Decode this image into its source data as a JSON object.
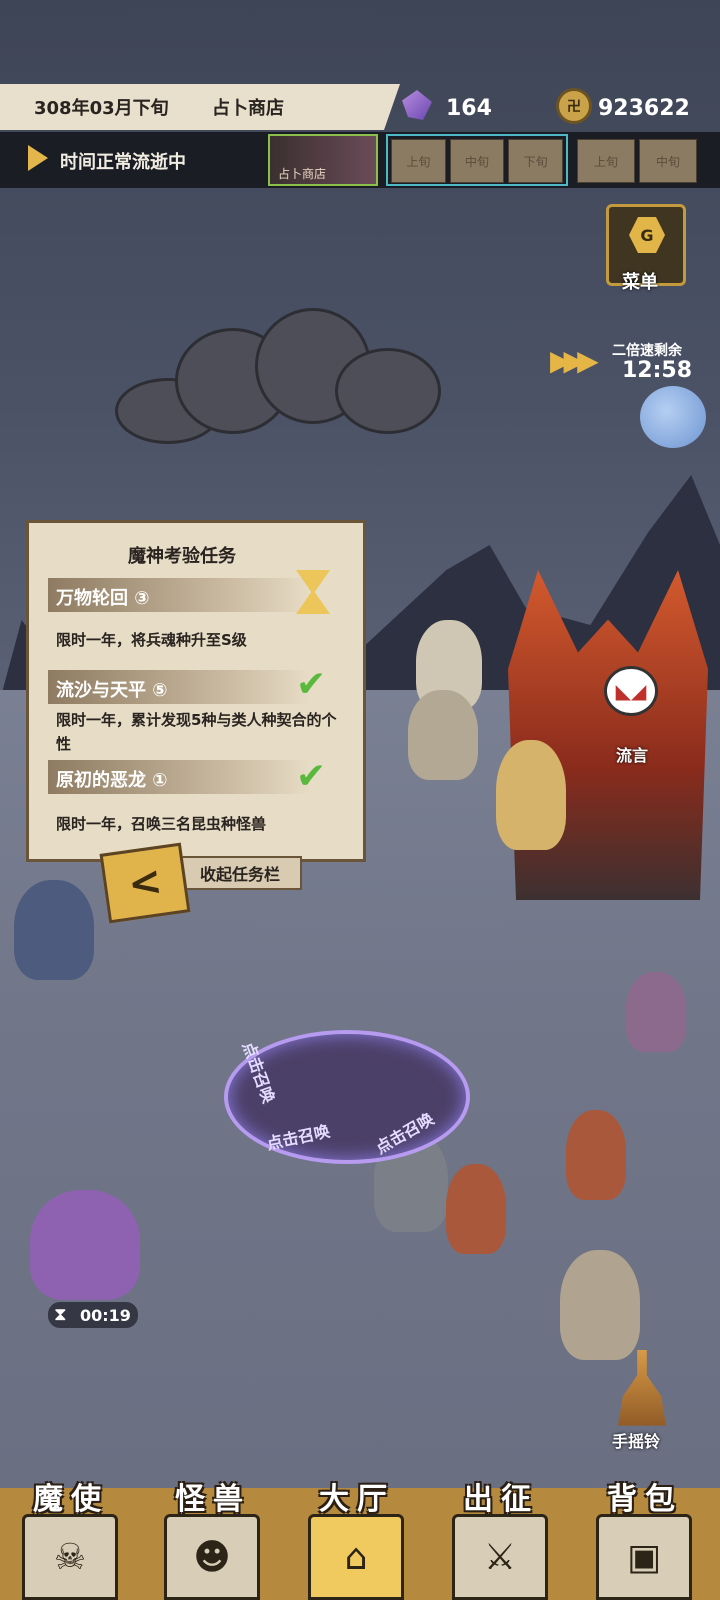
{
  "header": {
    "date": "308年03月下旬",
    "location": "占卜商店",
    "crystals": "164",
    "gold": "923622",
    "time_status": "时间正常流逝中",
    "shop_thumb_label": "占卜商店",
    "periods_current": [
      "上旬",
      "中旬",
      "下旬"
    ],
    "periods_next": [
      "上旬",
      "中旬"
    ]
  },
  "menu": {
    "label": "菜单",
    "icon_letter": "G"
  },
  "speed": {
    "label": "二倍速剩余",
    "time": "12:58"
  },
  "quest_panel": {
    "title": "魔神考验任务",
    "quests": [
      {
        "name": "万物轮回 ③",
        "desc": "限时一年，将兵魂种升至S级",
        "status": "in-progress"
      },
      {
        "name": "流沙与天平 ⑤",
        "desc": "限时一年，累计发现5种与类人种契合的个性",
        "status": "done"
      },
      {
        "name": "原初的恶龙 ①",
        "desc": "限时一年，召唤三名昆虫种怪兽",
        "status": "done"
      }
    ],
    "collapse_label": "收起任务栏"
  },
  "scene": {
    "rumor_label": "流言",
    "summon_text": [
      "点击召唤",
      "点击召唤",
      "点击召唤"
    ],
    "timer": "00:19",
    "bell_label": "手摇铃"
  },
  "nav": [
    {
      "label": "魔使",
      "icon": "skull-icon",
      "active": false
    },
    {
      "label": "怪兽",
      "icon": "monster-icon",
      "active": false
    },
    {
      "label": "大厅",
      "icon": "hall-icon",
      "active": true
    },
    {
      "label": "出征",
      "icon": "expedition-icon",
      "active": false
    },
    {
      "label": "背包",
      "icon": "backpack-icon",
      "active": false
    }
  ]
}
